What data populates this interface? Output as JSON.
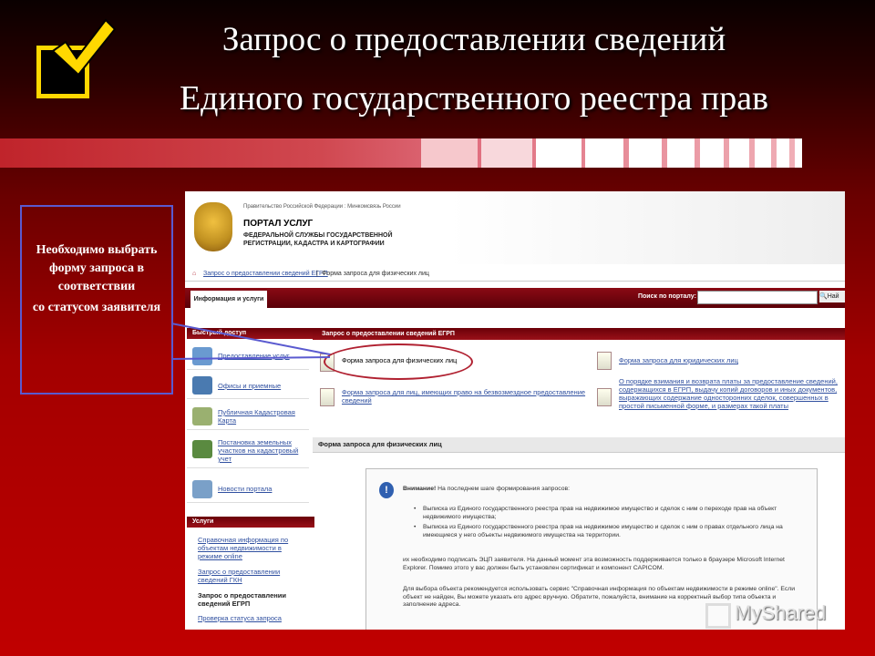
{
  "slide": {
    "title_line1": "Запрос о предоставлении сведений",
    "title_line2": "Единого государственного реестра прав",
    "note_line1": "Необходимо выбрать форму запроса в соответствии",
    "note_line2": "со статусом заявителя",
    "watermark": "MyShared",
    "accent_color": "#c00000",
    "checkbox_color": "#ffd800"
  },
  "portal": {
    "gov_line": "Правительство Российской Федерации : Минкомсвязь России",
    "portal_title": "ПОРТАЛ УСЛУГ",
    "dept": "ФЕДЕРАЛЬНОЙ СЛУЖБЫ ГОСУДАРСТВЕННОЙ РЕГИСТРАЦИИ, КАДАСТРА И КАРТОГРАФИИ",
    "breadcrumb_link": "Запрос о предоставлении сведений ЕГРП",
    "breadcrumb_current": "Форма запроса для физических лиц",
    "tab_label": "Информация и услуги",
    "search_label": "Поиск по порталу:",
    "search_button": "Най",
    "quick_access_head": "Быстрый доступ",
    "quick_items": [
      "Предоставление услуг",
      "Офисы и приемные",
      "Публичная Кадастровая Карта",
      "Постановка земельных участков на кадастровый учет",
      "Новости портала"
    ],
    "services_head": "Услуги",
    "services": [
      "Справочная информация по объектам недвижимости в режиме online",
      "Запрос о предоставлении сведений ГКН",
      "Запрос о предоставлении сведений ЕГРП",
      "Проверка статуса запроса"
    ],
    "main_head": "Запрос о предоставлении сведений ЕГРП",
    "forms": [
      "Форма запроса для физических лиц",
      "Форма запроса для юридических лиц",
      "Форма запроса для лиц, имеющих право на безвозмездное предоставление сведений",
      "О порядке взимания и возврата платы за предоставление сведений, содержащихся в ЕГРП, выдачу копий договоров и иных документов, выражающих содержание односторонних сделок, совершенных в простой письменной форме, и размерах такой платы"
    ],
    "section_head": "Форма запроса для физических лиц",
    "attention_bold": "Внимание!",
    "attention_text": "На последнем шаге формирования запросов:",
    "bullet1": "Выписка из Единого государственного реестра прав на недвижимое имущество и сделок с ним о переходе прав на объект недвижимого имущества;",
    "bullet2": "Выписка из Единого государственного реестра прав на недвижимое имущество и сделок с ним о правах отдельного лица на имеющиеся у него объекты недвижимого имущества на территории.",
    "para1": "их необходимо подписать ЭЦП заявителя. На данный момент эта возможность поддерживается только в браузере Microsoft Internet Explorer. Помимо этого у вас должен быть установлен сертификат и компонент CAPICOM.",
    "para2": "Для выбора объекта рекомендуется использовать сервис \"Справочная информация по объектам недвижимости в режиме online\". Если объект не найден, Вы можете указать его адрес вручную. Обратите, пожалуйста, внимание на корректный выбор типа объекта и заполнение адреса."
  }
}
